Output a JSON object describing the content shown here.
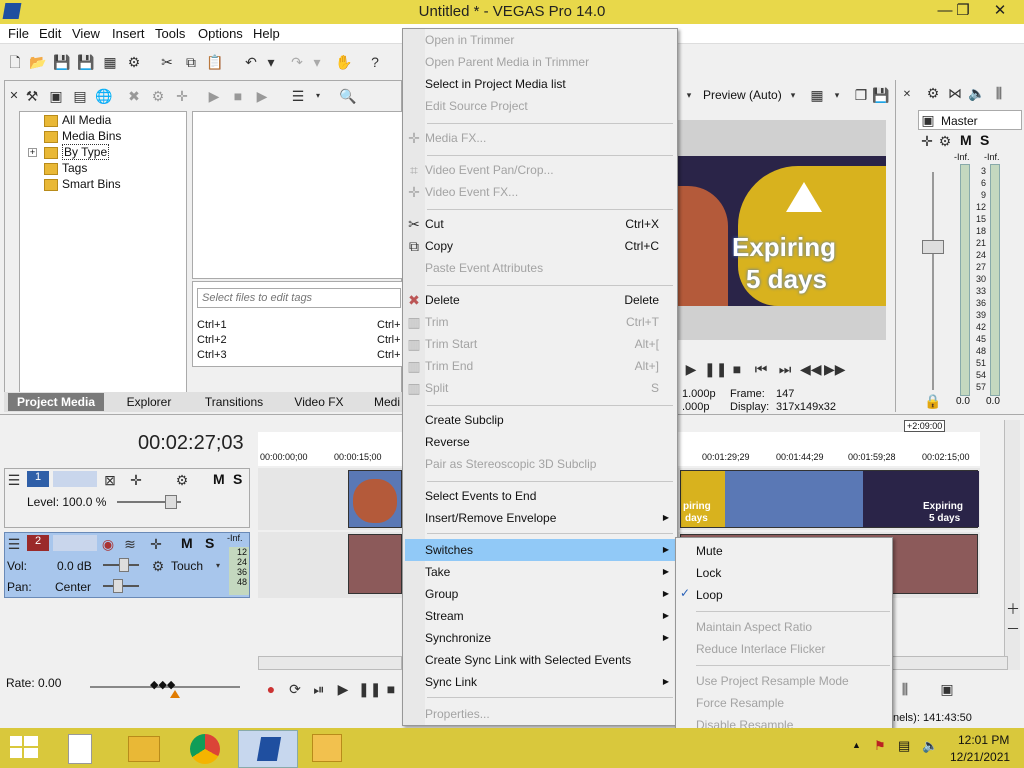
{
  "window": {
    "title": "Untitled * - VEGAS Pro 14.0",
    "min": "—",
    "restore": "❐",
    "close": "✕"
  },
  "menubar": [
    "File",
    "Edit",
    "View",
    "Insert",
    "Tools",
    "Options",
    "Help"
  ],
  "media_tree": [
    "All Media",
    "Media Bins",
    "By Type",
    "Tags",
    "Smart Bins"
  ],
  "media_tree_expander": "+",
  "tags": {
    "placeholder": "Select files to edit tags",
    "rows": [
      "Ctrl+1",
      "Ctrl+2",
      "Ctrl+3"
    ],
    "rows_right": [
      "Ctrl+",
      "Ctrl+",
      "Ctrl+"
    ]
  },
  "tabs": [
    "Project Media",
    "Explorer",
    "Transitions",
    "Video FX",
    "Medi"
  ],
  "preview": {
    "mode": "Preview (Auto)",
    "overlay_line1": "Expiring",
    "overlay_line2": "5 days",
    "rate_l1": "1.000p",
    "rate_l2": ".000p",
    "frame_label": "Frame:",
    "frame_value": "147",
    "display_label": "Display:",
    "display_value": "317x149x32"
  },
  "mixer": {
    "title": "Master",
    "m": "M",
    "s": "S",
    "inf_l": "-Inf.",
    "inf_r": "-Inf.",
    "scale": [
      "3",
      "6",
      "9",
      "12",
      "15",
      "18",
      "21",
      "24",
      "27",
      "30",
      "33",
      "36",
      "39",
      "42",
      "45",
      "48",
      "51",
      "54",
      "57"
    ],
    "bottom_l": "0.0",
    "bottom_r": "0.0"
  },
  "timeline": {
    "time": "00:02:27;03",
    "ruler": [
      "00:00:00;00",
      "00:00:15;00",
      "00:01:29;29",
      "00:01:44;29",
      "00:01:59;28",
      "00:02:15;00"
    ],
    "region_marker": "+2:09:00",
    "track1": {
      "num": "1",
      "level": "Level: 100.0 %",
      "m": "M",
      "s": "S"
    },
    "track2": {
      "num": "2",
      "vol_label": "Vol:",
      "vol_value": "0.0 dB",
      "pan_label": "Pan:",
      "pan_value": "Center",
      "m": "M",
      "s": "S",
      "touch": "Touch",
      "inf": "-Inf.",
      "levels": [
        "12",
        "24",
        "36",
        "48"
      ]
    },
    "clip_text1": "piring",
    "clip_text2": "days",
    "clip_text3": "Expiring",
    "clip_text4": "5 days",
    "rate": "Rate: 0.00",
    "channels": "nels): 141:43:50"
  },
  "context_menu": [
    {
      "label": "Open in Trimmer",
      "disabled": true
    },
    {
      "label": "Open Parent Media in Trimmer",
      "disabled": true
    },
    {
      "label": "Select in Project Media list",
      "disabled": false
    },
    {
      "label": "Edit Source Project",
      "disabled": true
    },
    {
      "label": "Media FX...",
      "disabled": true
    },
    {
      "label": "Video Event Pan/Crop...",
      "disabled": true
    },
    {
      "label": "Video Event FX...",
      "disabled": true
    },
    {
      "label": "Cut",
      "shortcut": "Ctrl+X",
      "disabled": false
    },
    {
      "label": "Copy",
      "shortcut": "Ctrl+C",
      "disabled": false
    },
    {
      "label": "Paste Event Attributes",
      "disabled": true
    },
    {
      "label": "Delete",
      "shortcut": "Delete",
      "disabled": false
    },
    {
      "label": "Trim",
      "shortcut": "Ctrl+T",
      "disabled": true
    },
    {
      "label": "Trim Start",
      "shortcut": "Alt+[",
      "disabled": true
    },
    {
      "label": "Trim End",
      "shortcut": "Alt+]",
      "disabled": true
    },
    {
      "label": "Split",
      "shortcut": "S",
      "disabled": true
    },
    {
      "label": "Create Subclip",
      "disabled": false
    },
    {
      "label": "Reverse",
      "disabled": false
    },
    {
      "label": "Pair as Stereoscopic 3D Subclip",
      "disabled": true
    },
    {
      "label": "Select Events to End",
      "disabled": false
    },
    {
      "label": "Insert/Remove Envelope",
      "disabled": false
    },
    {
      "label": "Switches",
      "disabled": false
    },
    {
      "label": "Take",
      "disabled": false
    },
    {
      "label": "Group",
      "disabled": false
    },
    {
      "label": "Stream",
      "disabled": false
    },
    {
      "label": "Synchronize",
      "disabled": false
    },
    {
      "label": "Create Sync Link with Selected Events",
      "disabled": false
    },
    {
      "label": "Sync Link",
      "disabled": false
    },
    {
      "label": "Properties...",
      "disabled": true
    }
  ],
  "submenu_switches": [
    {
      "label": "Mute",
      "disabled": false
    },
    {
      "label": "Lock",
      "disabled": false
    },
    {
      "label": "Loop",
      "disabled": false,
      "checked": true
    },
    {
      "label": "Maintain Aspect Ratio",
      "disabled": true
    },
    {
      "label": "Reduce Interlace Flicker",
      "disabled": true
    },
    {
      "label": "Use Project Resample Mode",
      "disabled": true
    },
    {
      "label": "Force Resample",
      "disabled": true
    },
    {
      "label": "Disable Resample",
      "disabled": true
    }
  ],
  "checkmark": "✓",
  "taskbar": {
    "time": "12:01 PM",
    "date": "12/21/2021"
  },
  "colors": {
    "titlebar": "#e8d84a",
    "taskbar": "#d9c83c",
    "menu_highlight": "#91c9f7",
    "track_panel": "#a8c6ec"
  }
}
